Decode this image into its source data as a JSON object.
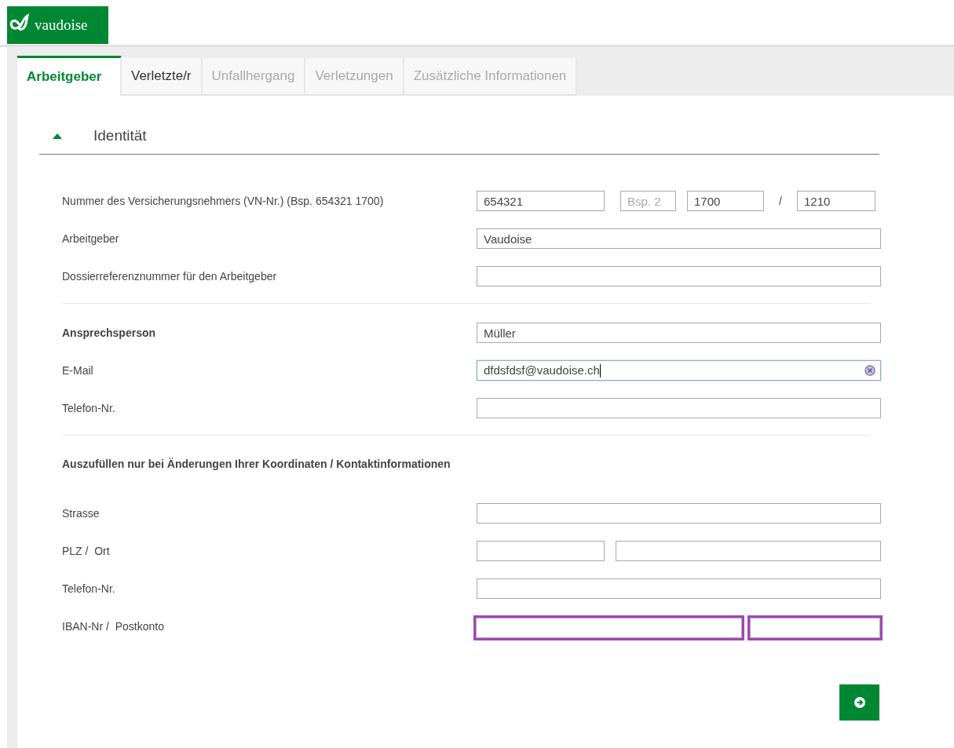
{
  "logo": {
    "text": "vaudoise"
  },
  "tabs": [
    {
      "label": "Arbeitgeber",
      "selected": true,
      "disabled": false
    },
    {
      "label": "Verletzte/r",
      "selected": false,
      "disabled": false
    },
    {
      "label": "Unfallhergang",
      "selected": false,
      "disabled": true
    },
    {
      "label": "Verletzungen",
      "selected": false,
      "disabled": true
    },
    {
      "label": "Zusätzliche Informationen",
      "selected": false,
      "disabled": true
    }
  ],
  "section": {
    "title": "Identität",
    "expanded": true
  },
  "rows": [
    {
      "kind": "vn",
      "label": "Nummer des Versicherungsnehmers (VN-Nr.) (Bsp. 654321 1700)",
      "bold": false,
      "fields": [
        {
          "kind": "input",
          "value": "654321"
        },
        {
          "kind": "input",
          "placeholder": "Bsp. 2"
        },
        {
          "kind": "input",
          "value": "1700"
        },
        {
          "kind": "text",
          "text": "/"
        },
        {
          "kind": "input",
          "value": "1210"
        }
      ]
    },
    {
      "kind": "single",
      "label": "Arbeitgeber",
      "bold": false,
      "fields": [
        {
          "kind": "input",
          "value": "Vaudoise"
        }
      ]
    },
    {
      "kind": "single",
      "label": "Dossierreferenznummer für den Arbeitgeber",
      "bold": false,
      "fields": [
        {
          "kind": "input"
        }
      ]
    },
    {
      "kind": "separator"
    },
    {
      "kind": "single",
      "label": "Ansprechsperson",
      "bold": true,
      "fields": [
        {
          "kind": "input",
          "value": "Müller"
        }
      ]
    },
    {
      "kind": "single",
      "label": "E-Mail",
      "bold": false,
      "fields": [
        {
          "kind": "input",
          "value": "dfdsfdsf@vaudoise.ch",
          "focused": true
        }
      ]
    },
    {
      "kind": "single",
      "label": "Telefon-Nr.",
      "bold": false,
      "fields": [
        {
          "kind": "input"
        }
      ]
    },
    {
      "kind": "separator"
    },
    {
      "kind": "heading",
      "label": "Auszufüllen nur bei Änderungen Ihrer Koordinaten / Kontaktinformationen"
    },
    {
      "kind": "single",
      "label": "Strasse",
      "bold": false,
      "fields": [
        {
          "kind": "input"
        }
      ]
    },
    {
      "kind": "pair",
      "label": "PLZ /  Ort",
      "bold": false,
      "fields": [
        {
          "kind": "input"
        },
        {
          "kind": "input"
        }
      ]
    },
    {
      "kind": "single",
      "label": "Telefon-Nr.",
      "bold": false,
      "fields": [
        {
          "kind": "input"
        }
      ]
    },
    {
      "kind": "iban",
      "label": "IBAN-Nr /  Postkonto",
      "bold": false,
      "fields": [
        {
          "kind": "input",
          "highlighted": true
        },
        {
          "kind": "input",
          "highlighted": true
        }
      ]
    }
  ]
}
